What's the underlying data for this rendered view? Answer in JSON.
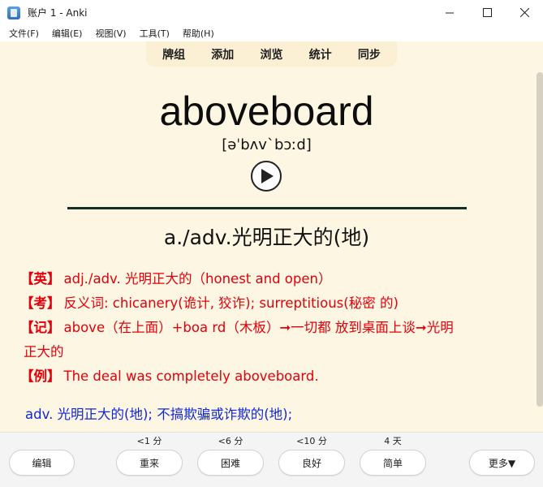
{
  "window": {
    "title": "账户 1 - Anki",
    "minimize": "—",
    "maximize": "☐",
    "close": "✕"
  },
  "menu": [
    "文件(F)",
    "编辑(E)",
    "视图(V)",
    "工具(T)",
    "帮助(H)"
  ],
  "toolbar": [
    "牌组",
    "添加",
    "浏览",
    "统计",
    "同步"
  ],
  "card": {
    "word": "aboveboard",
    "phonetic": "[əˈbʌvˋbɔːd]",
    "meaning": "a./adv.光明正大的(地)",
    "notes": [
      {
        "tag": "【英】",
        "text": "adj./adv. 光明正大的（honest and open）"
      },
      {
        "tag": "【考】",
        "text": "反义词: chicanery(诡计, 狡诈); surreptitious(秘密 的)"
      },
      {
        "tag": "【记】",
        "text": "above（在上面）+boa rd（木板）➞一切都 放到桌面上谈➞光明",
        "cont": "正大的"
      },
      {
        "tag": "【例】",
        "text": "The deal was completely aboveboard."
      }
    ],
    "definition": "adv. 光明正大的(地); 不搞欺骗或诈欺的(地);"
  },
  "bottom": {
    "edit": "编辑",
    "answers": [
      {
        "time": "<1 分",
        "label": "重来"
      },
      {
        "time": "<6 分",
        "label": "困难"
      },
      {
        "time": "<10 分",
        "label": "良好"
      },
      {
        "time": "4 天",
        "label": "简单"
      }
    ],
    "more": "更多▼"
  }
}
